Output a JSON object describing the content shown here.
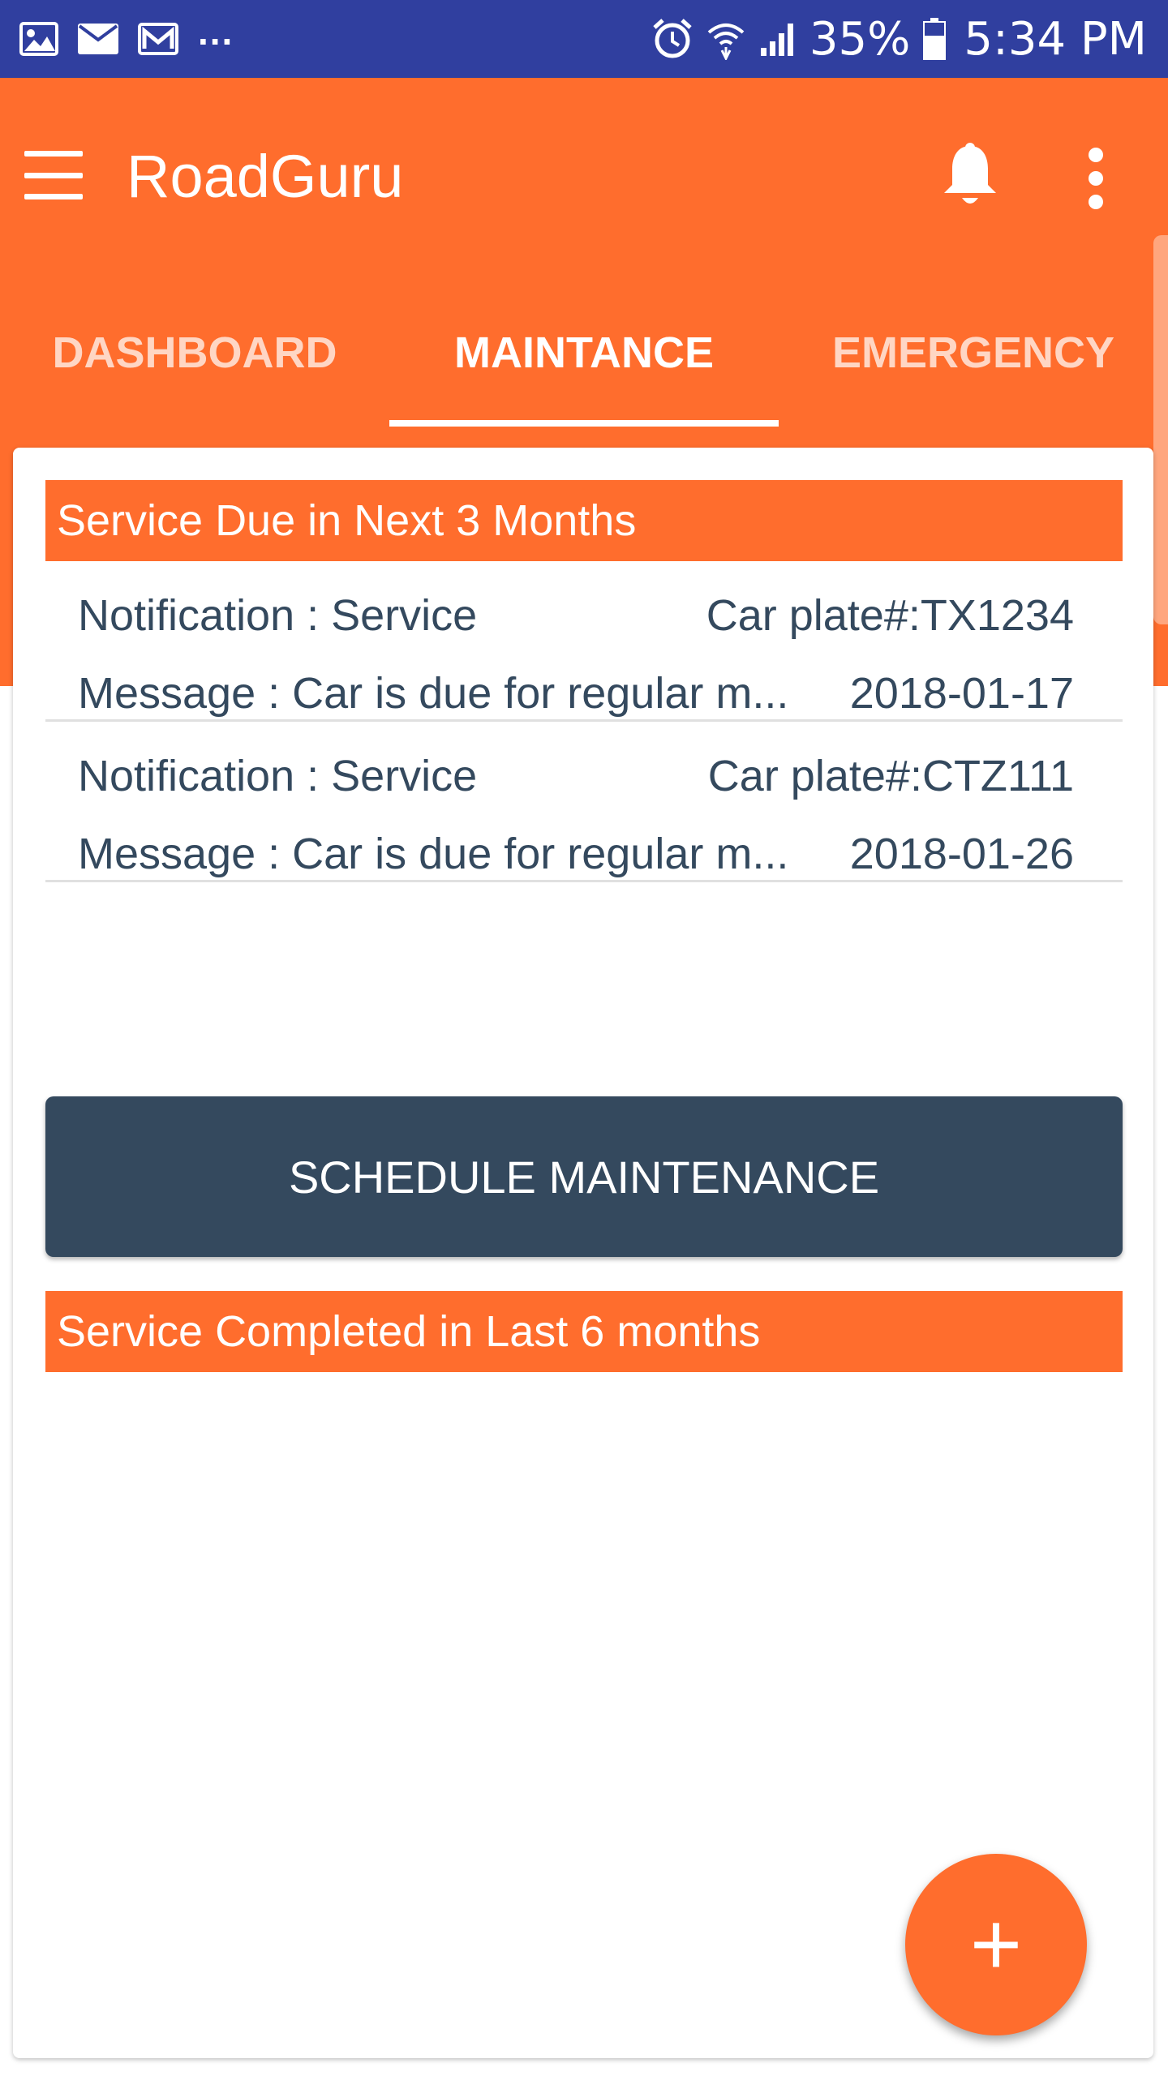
{
  "status_bar": {
    "left_icons": [
      "image-icon",
      "email-icon",
      "gmail-icon"
    ],
    "more": "...",
    "right_icons": [
      "alarm-icon",
      "wifi-icon",
      "signal-icon"
    ],
    "battery": "35%",
    "time": "5:34 PM"
  },
  "toolbar": {
    "title": "RoadGuru",
    "menu_icon": "hamburger-icon",
    "notification_icon": "bell-icon",
    "overflow_icon": "more-vert-icon"
  },
  "tabs": [
    {
      "label": "DASHBOARD",
      "active": false
    },
    {
      "label": "MAINTANCE",
      "active": true
    },
    {
      "label": "EMERGENCY",
      "active": false
    }
  ],
  "due_section": {
    "title": "Service Due in Next 3 Months",
    "items": [
      {
        "notification": "Notification : Service",
        "plate": "Car plate#:TX1234",
        "message": "Message : Car is due for regular m...",
        "date": "2018-01-17"
      },
      {
        "notification": "Notification : Service",
        "plate": "Car plate#:CTZ111",
        "message": "Message : Car is due for regular m...",
        "date": "2018-01-26"
      }
    ]
  },
  "schedule_button": {
    "label": "SCHEDULE MAINTENANCE"
  },
  "completed_section": {
    "title": "Service Completed in Last 6 months"
  },
  "fab": {
    "label": "+",
    "icon": "plus-icon"
  },
  "colors": {
    "accent": "#ff6d2d",
    "status_bar": "#303f9f",
    "button": "#34495e",
    "text": "#34495e"
  }
}
